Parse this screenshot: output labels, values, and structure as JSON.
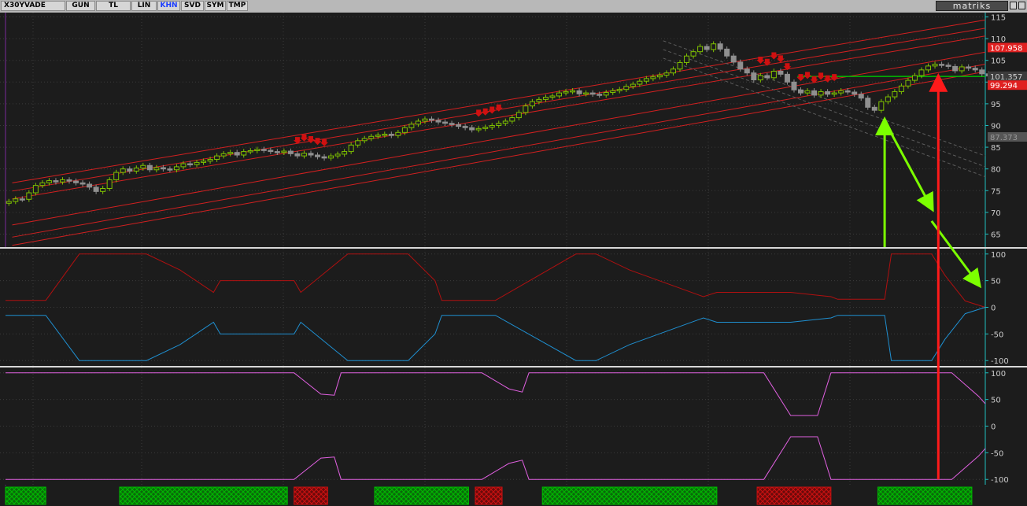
{
  "toolbar": {
    "symbol": "X30YVADE",
    "buttons": [
      "GUN",
      "TL",
      "LIN",
      "KHN",
      "SVD",
      "SYM",
      "TMP"
    ],
    "active_button": "KHN",
    "brand": "matriks"
  },
  "colors": {
    "bull_candle": "#7ec000",
    "bear_candle": "#8f8f8f",
    "channel": "#d22020",
    "dashed_channel": "#5c5c5c",
    "annotation_green": "#7cff00",
    "annotation_red": "#ff1a1a",
    "osc1_red": "#b01010",
    "osc1_blue": "#1f8fd0",
    "osc2_magenta": "#e060e0",
    "axis_line": "#1fc0c0",
    "signal_green": "#00bb00",
    "signal_red": "#cc1111"
  },
  "chart_data": [
    {
      "type": "candlestick",
      "panel": "price",
      "y_ticks": [
        65,
        70,
        75,
        80,
        85,
        90,
        95,
        100,
        105,
        110,
        115
      ],
      "ylim": [
        62,
        116
      ],
      "price_labels": [
        {
          "text": "107.958",
          "style": "red"
        },
        {
          "text": "101.357",
          "style": "dark"
        },
        {
          "text": "99.294",
          "style": "red"
        },
        {
          "text": "87.373",
          "style": "gray"
        }
      ],
      "close_series": [
        72.5,
        73.1,
        73.0,
        74.5,
        76.2,
        76.8,
        77.3,
        77.0,
        77.5,
        77.2,
        76.8,
        76.5,
        75.8,
        74.8,
        75.5,
        77.5,
        79.2,
        80.0,
        79.5,
        80.2,
        80.8,
        79.8,
        80.3,
        80.0,
        79.8,
        80.5,
        81.2,
        81.0,
        81.5,
        81.8,
        82.2,
        83.0,
        83.5,
        83.8,
        83.2,
        84.0,
        84.2,
        84.5,
        84.3,
        84.0,
        83.8,
        84.1,
        83.5,
        83.0,
        83.6,
        83.2,
        82.8,
        82.5,
        83.0,
        83.4,
        84.0,
        85.5,
        86.5,
        87.0,
        87.5,
        87.8,
        88.0,
        87.7,
        88.4,
        89.5,
        90.3,
        91.0,
        91.5,
        91.2,
        90.8,
        90.5,
        90.2,
        89.8,
        89.5,
        89.0,
        89.3,
        89.6,
        90.0,
        90.5,
        91.0,
        91.8,
        93.0,
        94.5,
        95.5,
        96.0,
        96.5,
        96.8,
        97.5,
        97.8,
        98.0,
        97.3,
        97.5,
        97.2,
        97.0,
        97.6,
        98.0,
        98.3,
        99.0,
        99.5,
        100.2,
        100.8,
        101.2,
        101.6,
        102.1,
        103.0,
        104.5,
        106.0,
        107.0,
        108.2,
        107.5,
        108.8,
        107.6,
        106.0,
        104.6,
        103.0,
        102.1,
        100.5,
        101.5,
        101.0,
        102.5,
        101.8,
        100.0,
        98.2,
        97.5,
        98.0,
        97.0,
        97.8,
        97.2,
        97.5,
        98.0,
        97.7,
        97.2,
        96.3,
        94.2,
        93.5,
        95.5,
        96.6,
        97.8,
        99.1,
        100.4,
        101.5,
        102.8,
        103.7,
        104.1,
        103.9,
        103.6,
        102.6,
        103.5,
        103.2,
        102.8,
        101.9,
        101.4
      ],
      "channel_lines": [
        {
          "style": "solid",
          "x": [
            1,
            146
          ],
          "y": [
            76.8,
            114.3
          ]
        },
        {
          "style": "solid",
          "x": [
            1,
            146
          ],
          "y": [
            74.9,
            112.4
          ]
        },
        {
          "style": "solid",
          "x": [
            1,
            146
          ],
          "y": [
            73.1,
            110.6
          ]
        },
        {
          "style": "solid",
          "x": [
            1,
            146
          ],
          "y": [
            67.1,
            106.9
          ]
        },
        {
          "style": "solid",
          "x": [
            1,
            146
          ],
          "y": [
            64.3,
            104.1
          ]
        },
        {
          "style": "solid",
          "x": [
            1,
            146
          ],
          "y": [
            62.4,
            102.4
          ]
        },
        {
          "style": "dashed",
          "x": [
            98,
            146
          ],
          "y": [
            109.5,
            83.0
          ]
        },
        {
          "style": "dashed",
          "x": [
            98,
            146
          ],
          "y": [
            107.5,
            80.5
          ]
        },
        {
          "style": "dashed",
          "x": [
            98,
            146
          ],
          "y": [
            105.5,
            78.2
          ]
        }
      ],
      "reference_lines": [
        {
          "x": [
            118,
            146
          ],
          "y": [
            101.3,
            101.3
          ],
          "color": "green"
        }
      ]
    },
    {
      "type": "line",
      "panel": "oscillator-1",
      "y_ticks": [
        100,
        50,
        0,
        -50,
        -100
      ],
      "ylim": [
        -110,
        110
      ],
      "series": [
        {
          "color": "red",
          "x": [
            0,
            6,
            11,
            21,
            26,
            31,
            32,
            36,
            43,
            44,
            51,
            60,
            64,
            65,
            73,
            85,
            87,
            88,
            93,
            104,
            106,
            110,
            117,
            123,
            124,
            131,
            132,
            138,
            140,
            143,
            146
          ],
          "y": [
            13,
            13,
            100,
            100,
            70,
            28,
            50,
            50,
            50,
            28,
            100,
            100,
            50,
            13,
            13,
            100,
            100,
            100,
            70,
            20,
            28,
            28,
            28,
            20,
            15,
            15,
            100,
            100,
            60,
            12,
            0
          ]
        },
        {
          "color": "blue",
          "x": [
            0,
            6,
            11,
            21,
            26,
            31,
            32,
            36,
            43,
            44,
            51,
            60,
            64,
            65,
            73,
            85,
            87,
            88,
            93,
            104,
            106,
            110,
            117,
            123,
            124,
            131,
            132,
            138,
            140,
            143,
            146
          ],
          "y": [
            -15,
            -15,
            -100,
            -100,
            -70,
            -28,
            -50,
            -50,
            -50,
            -28,
            -100,
            -100,
            -50,
            -15,
            -15,
            -100,
            -100,
            -100,
            -70,
            -20,
            -28,
            -28,
            -28,
            -20,
            -15,
            -15,
            -100,
            -100,
            -60,
            -12,
            0
          ]
        }
      ]
    },
    {
      "type": "line",
      "panel": "oscillator-2",
      "y_ticks": [
        100,
        50,
        0,
        -50,
        -100
      ],
      "ylim": [
        -110,
        110
      ],
      "series": [
        {
          "color": "magenta",
          "x": [
            0,
            6,
            11,
            43,
            47,
            49,
            50,
            55,
            71,
            75,
            77,
            78,
            86,
            88,
            93,
            113,
            117,
            121,
            123,
            127,
            133,
            138,
            140,
            141,
            145,
            146
          ],
          "y": [
            100,
            100,
            100,
            100,
            60,
            58,
            100,
            100,
            100,
            70,
            64,
            100,
            100,
            100,
            100,
            100,
            20,
            20,
            100,
            100,
            100,
            100,
            100,
            100,
            56,
            42
          ]
        },
        {
          "color": "magenta",
          "x": [
            0,
            6,
            11,
            43,
            47,
            49,
            50,
            55,
            71,
            75,
            77,
            78,
            86,
            88,
            93,
            113,
            117,
            121,
            123,
            127,
            133,
            138,
            140,
            141,
            145,
            146
          ],
          "y": [
            -100,
            -100,
            -100,
            -100,
            -60,
            -58,
            -100,
            -100,
            -100,
            -70,
            -64,
            -100,
            -100,
            -100,
            -100,
            -100,
            -20,
            -20,
            -100,
            -100,
            -100,
            -100,
            -100,
            -100,
            -56,
            -42
          ]
        }
      ]
    },
    {
      "type": "signal_bars",
      "panel": "signals",
      "x_ranges": [
        {
          "start": 1,
          "end": 6,
          "color": "green"
        },
        {
          "start": 18,
          "end": 42,
          "color": "green"
        },
        {
          "start": 44,
          "end": 48,
          "color": "red"
        },
        {
          "start": 56,
          "end": 69,
          "color": "green"
        },
        {
          "start": 71,
          "end": 74,
          "color": "red"
        },
        {
          "start": 81,
          "end": 106,
          "color": "green"
        },
        {
          "start": 113,
          "end": 123,
          "color": "red"
        },
        {
          "start": 131,
          "end": 144,
          "color": "green"
        }
      ]
    }
  ],
  "markers": {
    "sell_arrows_x": [
      44,
      45,
      46,
      47,
      48,
      71,
      72,
      73,
      74,
      113,
      114,
      115,
      116,
      117,
      119,
      120,
      121,
      122,
      123,
      124
    ],
    "arrow_annotations": [
      {
        "color": "green",
        "from": [
          131,
          64
        ],
        "to": [
          131,
          91
        ]
      },
      {
        "color": "green",
        "from": [
          131,
          91
        ],
        "to": [
          138,
          71
        ]
      },
      {
        "color": "green",
        "from": [
          138,
          68
        ],
        "to": [
          145,
          43
        ]
      },
      {
        "color": "red",
        "from": [
          139,
          -100
        ],
        "to": [
          139,
          101
        ]
      }
    ]
  }
}
